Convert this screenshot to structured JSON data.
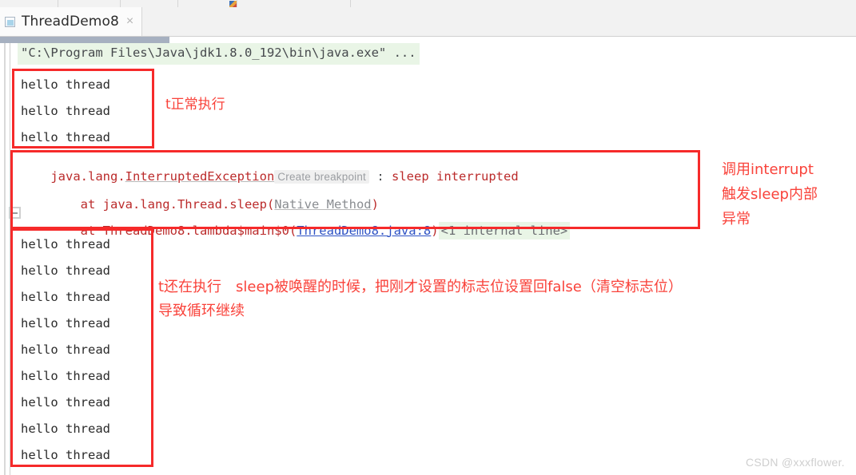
{
  "toolbar": {
    "separator_positions": [
      72,
      150,
      222,
      296,
      438
    ],
    "mini_icon_x": 287
  },
  "tab": {
    "title": "ThreadDemo8",
    "close_label": "×",
    "icon": "run-configuration-icon"
  },
  "console": {
    "command_line": "\"C:\\Program Files\\Java\\jdk1.8.0_192\\bin\\java.exe\" ...",
    "top_output_lines": [
      "hello thread",
      "hello thread",
      "hello thread"
    ],
    "exception": {
      "line1_prefix": "java.lang.",
      "line1_class": "InterruptedException",
      "line1_breakpoint_hint": "Create breakpoint",
      "line1_separator": " : ",
      "line1_message": "sleep interrupted",
      "line2_at": "    at java.lang.Thread.sleep(",
      "line2_link": "Native Method",
      "line2_close": ")",
      "line3_at": "    at ThreadDemo8.lambda$main$0(",
      "line3_link": "ThreadDemo8.java:8",
      "line3_close": ")",
      "line3_internal": "<1 internal line>"
    },
    "bottom_output_lines": [
      "hello thread",
      "hello thread",
      "hello thread",
      "hello thread",
      "hello thread",
      "hello thread",
      "hello thread",
      "hello thread",
      "hello thread"
    ]
  },
  "annotations": {
    "top": "t正常执行",
    "right_line1": "调用interrupt",
    "right_line2": "触发sleep内部",
    "right_line3": "异常",
    "middle_line1": "t还在执行　sleep被唤醒的时候，把刚才设置的标志位设置回false（清空标志位）",
    "middle_line2": "导致循环继续"
  },
  "watermark": "CSDN @xxxflower.",
  "colors": {
    "annotation_red": "#f9423a",
    "box_red": "#f62a2a",
    "exception_red": "#bb2b2b",
    "highlight_green": "#e9f5e6",
    "link_blue": "#2e52c4",
    "text_dark": "#46494d"
  }
}
